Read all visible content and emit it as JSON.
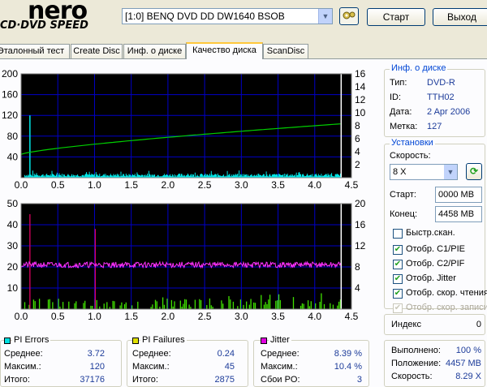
{
  "header": {
    "logo_top": "nero",
    "logo_bottom": "CD·DVD SPEED",
    "drive": "[1:0]  BENQ DVD DD DW1640 BSOB",
    "start_label": "Старт",
    "exit_label": "Выход"
  },
  "tabs": [
    {
      "label": "Эталонный тест"
    },
    {
      "label": "Create Disc"
    },
    {
      "label": "Инф. о диске"
    },
    {
      "label": "Качество диска"
    },
    {
      "label": "ScanDisc"
    }
  ],
  "disc_info": {
    "title": "Инф. о диске",
    "type_label": "Тип:",
    "type_value": "DVD-R",
    "id_label": "ID:",
    "id_value": "TTH02",
    "date_label": "Дата:",
    "date_value": "2 Apr 2006",
    "mark_label": "Метка:",
    "mark_value": "127"
  },
  "settings": {
    "title": "Установки",
    "speed_label": "Скорость:",
    "speed_value": "8 X",
    "start_label": "Старт:",
    "start_value": "0000 MB",
    "end_label": "Конец:",
    "end_value": "4458 MB",
    "quick_scan": "Быстр.скан.",
    "show_c1pie": "Отобр. C1/PIE",
    "show_c2pif": "Отобр. C2/PIF",
    "show_jitter": "Отобр. Jitter",
    "show_read_speed": "Отобр. скор. чтения",
    "show_write_speed": "Отобр. скор. записи"
  },
  "index": {
    "label": "Индекс",
    "value": "0"
  },
  "progress": {
    "done_label": "Выполнено:",
    "done_value": "100 %",
    "pos_label": "Положение:",
    "pos_value": "4457 MB",
    "speed_label": "Скорость:",
    "speed_value": "8.29 X"
  },
  "stats": {
    "pi_errors": {
      "title": "PI Errors",
      "color": "#00e0e0",
      "avg_label": "Среднее:",
      "avg": "3.72",
      "max_label": "Максим.:",
      "max": "120",
      "total_label": "Итого:",
      "total": "37176"
    },
    "pi_failures": {
      "title": "PI Failures",
      "color": "#e0e000",
      "avg_label": "Среднее:",
      "avg": "0.24",
      "max_label": "Максим.:",
      "max": "45",
      "total_label": "Итого:",
      "total": "2875"
    },
    "jitter": {
      "title": "Jitter",
      "color": "#e000e0",
      "avg_label": "Среднее:",
      "avg": "8.39 %",
      "max_label": "Максим.:",
      "max": "10.4 %",
      "po_label": "Сбои PO:",
      "po": "3"
    }
  },
  "chart_data": [
    {
      "type": "bar",
      "name": "PI Errors",
      "x_ticks": [
        "0.0",
        "0.5",
        "1.0",
        "1.5",
        "2.0",
        "2.5",
        "3.0",
        "3.5",
        "4.0",
        "4.5"
      ],
      "y_ticks_left": [
        "200",
        "160",
        "120",
        "80",
        "40"
      ],
      "y_ticks_right": [
        "16",
        "14",
        "12",
        "10",
        "8",
        "6",
        "4",
        "2"
      ],
      "xlim": [
        0,
        4.5
      ],
      "ylim": [
        0,
        200
      ],
      "y2lim": [
        0,
        16
      ],
      "spike": {
        "x": 0.12,
        "y": 120
      },
      "read_speed": {
        "start": 3.6,
        "end": 8.3
      }
    },
    {
      "type": "bar",
      "name": "PI Failures",
      "x_ticks": [
        "0.0",
        "0.5",
        "1.0",
        "1.5",
        "2.0",
        "2.5",
        "3.0",
        "3.5",
        "4.0",
        "4.5"
      ],
      "y_ticks_left": [
        "50",
        "40",
        "30",
        "20",
        "10"
      ],
      "y_ticks_right": [
        "20",
        "16",
        "12",
        "8",
        "4"
      ],
      "xlim": [
        0,
        4.5
      ],
      "ylim": [
        0,
        50
      ],
      "y2lim": [
        0,
        20
      ],
      "spikes": [
        {
          "x": 0.12,
          "y": 45
        },
        {
          "x": 1.01,
          "y": 38
        }
      ],
      "jitter_avg": 8.4
    }
  ]
}
